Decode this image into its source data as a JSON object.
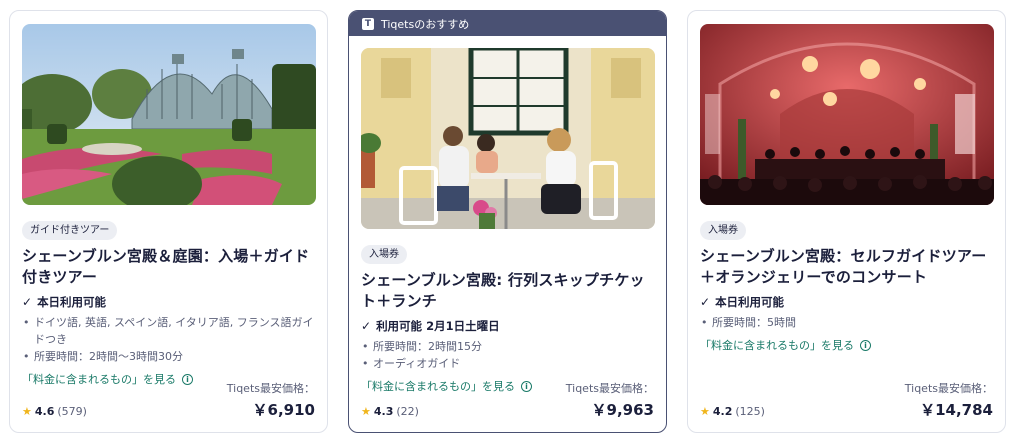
{
  "recommend_banner": "Tiqetsのおすすめ",
  "cards": [
    {
      "badge": "ガイド付きツアー",
      "title": "シェーンブルン宮殿＆庭園：入場＋ガイド付きツアー",
      "availability": "本日利用可能",
      "features": [
        "ドイツ語, 英語, スペイン語, イタリア語, フランス語ガイドつき",
        "所要時間：2時間〜3時間30分"
      ],
      "included_link": "「料金に含まれるもの」を見る",
      "rating": "4.6",
      "review_count": "(579)",
      "price_label": "Tiqets最安価格：",
      "price": "￥6,910"
    },
    {
      "badge": "入場券",
      "title": "シェーンブルン宮殿: 行列スキップチケット＋ランチ",
      "availability": "利用可能 2月1日土曜日",
      "features": [
        "所要時間：2時間15分",
        "オーディオガイド"
      ],
      "included_link": "「料金に含まれるもの」を見る",
      "rating": "4.3",
      "review_count": "(22)",
      "price_label": "Tiqets最安価格：",
      "price": "￥9,963"
    },
    {
      "badge": "入場券",
      "title": "シェーンブルン宮殿：セルフガイドツアー＋オランジェリーでのコンサート",
      "availability": "本日利用可能",
      "features": [
        "所要時間：5時間"
      ],
      "included_link": "「料金に含まれるもの」を見る",
      "rating": "4.2",
      "review_count": "(125)",
      "price_label": "Tiqets最安価格：",
      "price": "￥14,784"
    }
  ]
}
